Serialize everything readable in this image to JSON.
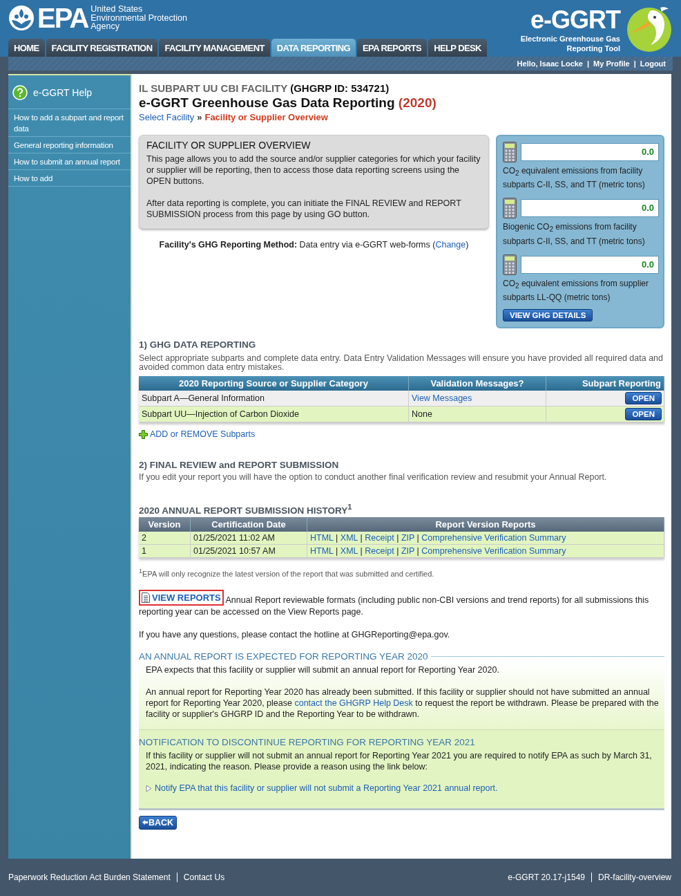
{
  "header": {
    "agency_mark": "EPA",
    "agency_name": [
      "United States",
      "Environmental Protection",
      "Agency"
    ],
    "tool_logo": "e-GGRT",
    "tool_name": [
      "Electronic Greenhouse Gas",
      "Reporting Tool"
    ]
  },
  "tabs": [
    {
      "label": "HOME",
      "selected": false
    },
    {
      "label": "FACILITY REGISTRATION",
      "selected": false
    },
    {
      "label": "FACILITY MANAGEMENT",
      "selected": false
    },
    {
      "label": "DATA REPORTING",
      "selected": true
    },
    {
      "label": "EPA REPORTS",
      "selected": false
    },
    {
      "label": "HELP DESK",
      "selected": false
    }
  ],
  "user_bar": {
    "greeting": "Hello, Isaac Locke",
    "separator": "|",
    "links": [
      "My Profile",
      "Logout"
    ]
  },
  "sidebar": {
    "title": "e-GGRT Help",
    "items": [
      "How to add a subpart and report data",
      "General reporting information",
      "How to submit an annual report",
      "How to add"
    ]
  },
  "page": {
    "facility": "IL SUBPART UU CBI FACILITY",
    "facility_id": "(GHGRP ID: 534721)",
    "title": "e-GGRT Greenhouse Gas Data Reporting",
    "year": "(2020)",
    "breadcrumb": [
      "Select Facility",
      "Facility or Supplier Overview"
    ],
    "breadcrumb_separator": "»"
  },
  "overview": {
    "title": "FACILITY OR SUPPLIER OVERVIEW",
    "paragraphs": [
      "This page allows you to add the source and/or supplier categories for which your facility or supplier will be reporting, then to access those data reporting screens using the OPEN buttons.",
      "After data reporting is complete, you can initiate the FINAL REVIEW and REPORT SUBMISSION process from this page by using GO button."
    ]
  },
  "method": {
    "label": "Facility's GHG Reporting Method:",
    "value": "Data entry via e-GGRT web-forms (",
    "link": "Change",
    "value_end": ")"
  },
  "emissions": {
    "items": [
      {
        "value": "0.0",
        "label": "CO$_{2}$ equivalent emissions from facility subparts C-II, SS, and TT (metric tons)"
      },
      {
        "value": "0.0",
        "label": "Biogenic CO$_{2}$ emissions from facility subparts C-II, SS, and TT (metric tons)"
      },
      {
        "value": "0.0",
        "label": "CO$_{2}$ equivalent emissions from supplier subparts LL-QQ (metric tons)"
      }
    ],
    "button": "VIEW GHG DETAILS"
  },
  "ghg_reporting": {
    "heading": "1) GHG DATA REPORTING",
    "description": "Select appropriate subparts and complete data entry. Data Entry Validation Messages will ensure you have provided all required data and avoided common data entry mistakes.",
    "columns": [
      "2020 Reporting Source or Supplier Category",
      "Validation Messages?",
      "Subpart Reporting"
    ],
    "rows": [
      {
        "category": "Subpart A—General Information",
        "validation": "View Messages",
        "kind": "link",
        "action": "OPEN"
      },
      {
        "category": "Subpart UU—Injection of Carbon Dioxide",
        "validation": "None",
        "kind": "text",
        "action": "OPEN"
      }
    ],
    "add_link": "ADD or REMOVE Subparts"
  },
  "final_review": {
    "heading": "2) FINAL REVIEW and REPORT SUBMISSION",
    "description": "If you edit your report you will have the option to conduct another final verification review and resubmit your Annual Report."
  },
  "history": {
    "heading": "2020 ANNUAL REPORT SUBMISSION HISTORY$^{1}$",
    "columns": [
      "Version",
      "Certification Date",
      "Report Version Reports"
    ],
    "link_separator": "|",
    "rows": [
      {
        "version": "2",
        "date": "01/25/2021 11:02 AM",
        "links": [
          "HTML",
          "XML",
          "Receipt",
          "ZIP",
          "Comprehensive Verification Summary"
        ]
      },
      {
        "version": "1",
        "date": "01/25/2021 10:57 AM",
        "links": [
          "HTML",
          "XML",
          "Receipt",
          "ZIP",
          "Comprehensive Verification Summary"
        ]
      }
    ],
    "footnote": "$^{1}$EPA will only recognize the latest version of the report that was submitted and certified."
  },
  "view_reports": {
    "link": "VIEW REPORTS",
    "text": "Annual Report reviewable formats (including public non-CBI versions and trend reports) for all submissions this reporting year can be accessed on the View Reports page.",
    "highlighted": true
  },
  "contact": "If you have any questions, please contact the hotline at GHGReporting@epa.gov.",
  "expected": {
    "heading": "AN ANNUAL REPORT IS EXPECTED FOR REPORTING YEAR 2020",
    "paragraph": "EPA expects that this facility or supplier will submit an annual report for Reporting Year 2020.",
    "note_before": "An annual report for Reporting Year 2020 has already been submitted. If this facility or supplier should not have submitted an annual report for Reporting Year 2020, please ",
    "note_link": "contact the GHGRP Help Desk",
    "note_after": " to request the report be withdrawn. Please be prepared with the facility or supplier's GHGRP ID and the Reporting Year to be withdrawn."
  },
  "discontinue": {
    "heading": "NOTIFICATION TO DISCONTINUE REPORTING FOR REPORTING YEAR 2021",
    "text": "If this facility or supplier will not submit an annual report for Reporting Year 2021 you are required to notify EPA as such by March 31, 2021, indicating the reason. Please provide a reason using the link below:",
    "link": "Notify EPA that this facility or supplier will not submit a Reporting Year 2021 annual report."
  },
  "back_button": "BACK",
  "footer": {
    "left": [
      "Paperwork Reduction Act Burden Statement",
      "Contact Us"
    ],
    "right": [
      "e-GGRT 20.17-j1549",
      "DR-facility-overview"
    ]
  }
}
